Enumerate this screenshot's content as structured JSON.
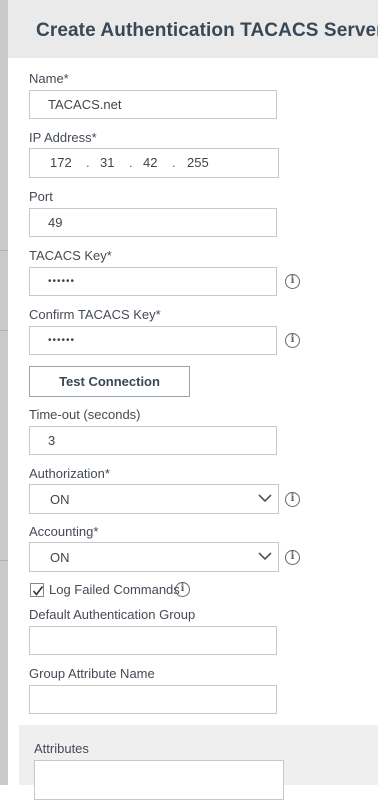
{
  "title": "Create Authentication TACACS Server",
  "name": {
    "label": "Name*",
    "value": "TACACS.net"
  },
  "ip_address": {
    "label": "IP Address*",
    "octets": [
      "172",
      "31",
      "42",
      "255"
    ]
  },
  "port": {
    "label": "Port",
    "value": "49"
  },
  "tacacs_key": {
    "label": "TACACS Key*",
    "value": "••••••"
  },
  "confirm_key": {
    "label": "Confirm TACACS Key*",
    "value": "••••••"
  },
  "test_connection": {
    "label": "Test Connection"
  },
  "timeout": {
    "label": "Time-out (seconds)",
    "value": "3"
  },
  "authorization": {
    "label": "Authorization*",
    "value": "ON"
  },
  "accounting": {
    "label": "Accounting*",
    "value": "ON"
  },
  "log_failed_commands": {
    "label": "Log Failed Commands",
    "checked": true
  },
  "default_auth_group": {
    "label": "Default Authentication Group",
    "value": ""
  },
  "group_attribute_name": {
    "label": "Group Attribute Name",
    "value": ""
  },
  "attributes": {
    "label": "Attributes",
    "value": ""
  },
  "icons": {
    "info": "info-circle-icon",
    "chevron": "chevron-down-icon",
    "check": "checkmark-icon"
  },
  "colors": {
    "title": "#3a4856",
    "header_bg": "#eaeaea",
    "border": "#c8c8c8"
  }
}
